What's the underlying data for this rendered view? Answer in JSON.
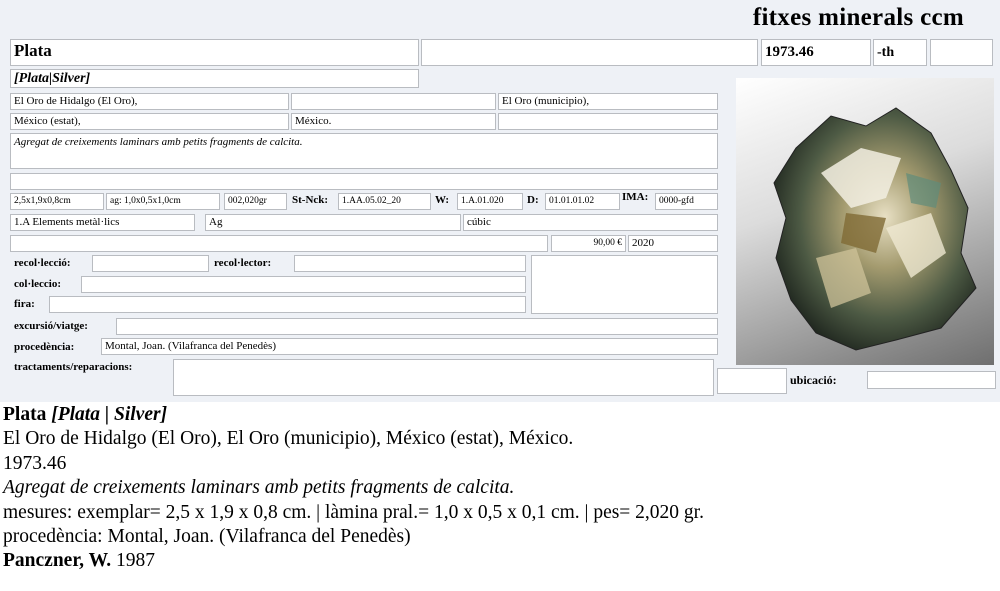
{
  "brand": "fitxes minerals ccm",
  "card": {
    "name": "Plata",
    "catalog_number": "1973.46",
    "suffix": "-th",
    "synonyms": "[Plata|Silver]",
    "locality": [
      "El Oro de Hidalgo (El Oro),",
      "El Oro (municipio),",
      "México (estat),",
      "México."
    ],
    "description": "Agregat de creixements laminars amb petits fragments de calcita.",
    "measures": {
      "specimen": "2,5x1,9x0,8cm",
      "crystal": "ag: 1,0x0,5x1,0cm",
      "weight": "002,020gr"
    },
    "strunz_label": "St-Nck:",
    "strunz": "1.AA.05.02_20",
    "w_label": "W:",
    "w": "1.A.01.020",
    "d_label": "D:",
    "d": "01.01.01.02",
    "ima_label": "IMA:",
    "ima": "0000-gfd",
    "class": "1.A Elements metàl·lics",
    "formula": "Ag",
    "system": "cúbic",
    "price": "90,00 €",
    "year": "2020",
    "fields": {
      "recollection_label": "recol·lecció:",
      "collector_label": "recol·lector:",
      "collection_label": "col·leccio:",
      "fair_label": "fira:",
      "trip_label": "excursió/viatge:",
      "provenance_label": "procedència:",
      "provenance": "Montal, Joan. (Vilafranca del Penedès)",
      "treatments_label": "tractaments/reparacions:",
      "location_label": "ubicació:"
    }
  },
  "summary": {
    "name": "Plata",
    "synonyms": "[Plata | Silver]",
    "locality": "El Oro de Hidalgo (El Oro), El Oro (municipio), México (estat), México.",
    "catalog_number": "1973.46",
    "description": "Agregat de creixements laminars amb petits fragments de calcita.",
    "measures": "mesures: exemplar= 2,5 x 1,9 x 0,8 cm. | làmina pral.= 1,0 x 0,5 x 0,1 cm. | pes= 2,020 gr.",
    "provenance": "procedència: Montal, Joan. (Vilafranca del Penedès)",
    "reference_author": "Panczner, W.",
    "reference_year": "1987"
  },
  "colors": {
    "card_background": "#eef1f6",
    "field_border": "#b9bcc1"
  },
  "icons": {
    "photo": "silver-specimen-photo"
  }
}
